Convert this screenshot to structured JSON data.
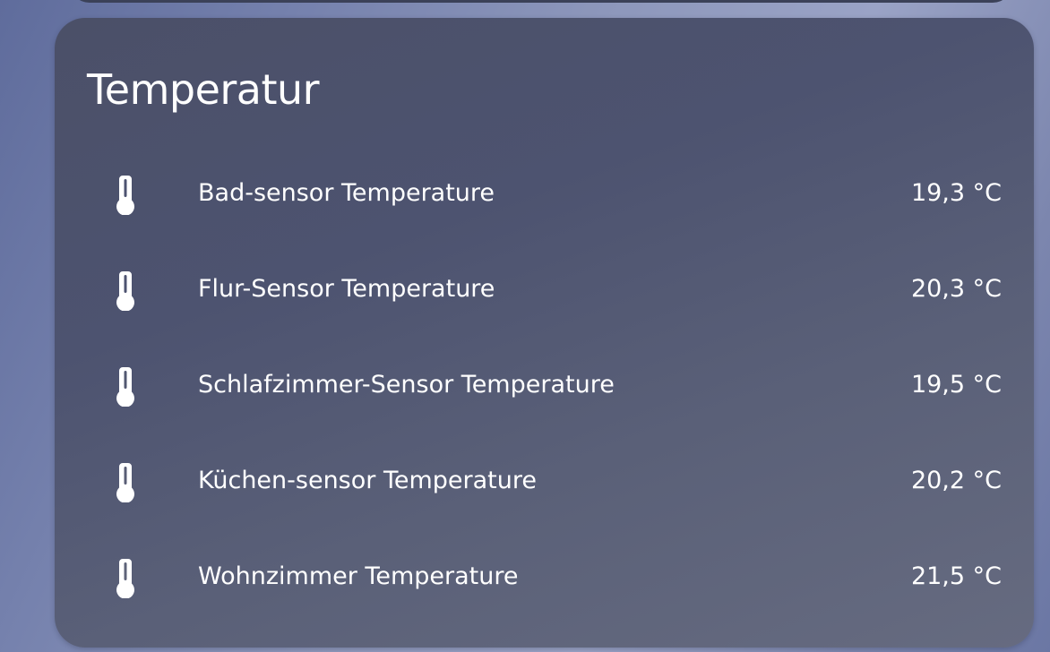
{
  "card": {
    "title": "Temperatur",
    "entities": [
      {
        "name": "Bad-sensor Temperature",
        "state": "19,3 °C",
        "icon": "thermometer-icon"
      },
      {
        "name": "Flur-Sensor Temperature",
        "state": "20,3 °C",
        "icon": "thermometer-icon"
      },
      {
        "name": "Schlafzimmer-Sensor Temperature",
        "state": "19,5 °C",
        "icon": "thermometer-icon"
      },
      {
        "name": "Küchen-sensor Temperature",
        "state": "20,2 °C",
        "icon": "thermometer-icon"
      },
      {
        "name": "Wohnzimmer Temperature",
        "state": "21,5 °C",
        "icon": "thermometer-icon"
      }
    ]
  },
  "colors": {
    "text": "#ffffff",
    "card_background": "#4d5370",
    "page_background": "#7c86ae"
  }
}
